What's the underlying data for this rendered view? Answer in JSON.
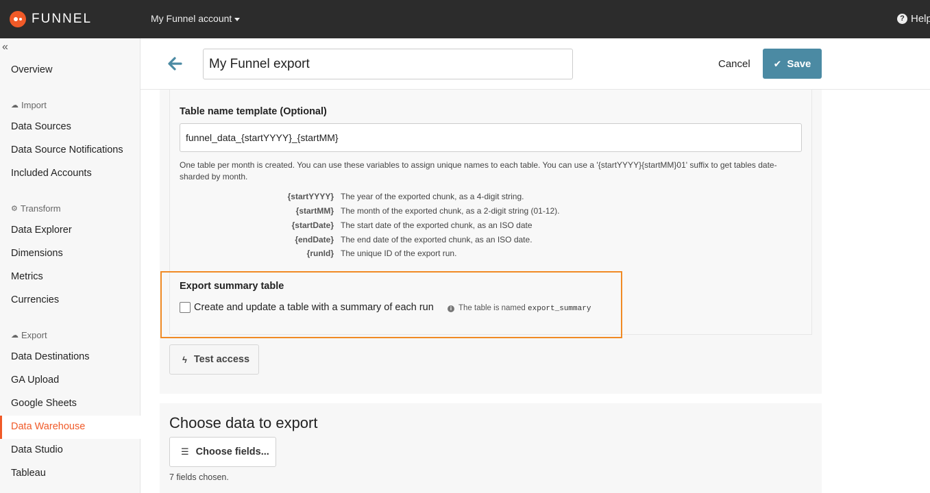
{
  "topbar": {
    "brand": "FUNNEL",
    "account": "My Funnel account",
    "help": "Help"
  },
  "sidebar": {
    "collapse_icon": "double-chevron-left-icon",
    "overview": "Overview",
    "sections": {
      "import": {
        "label": "Import",
        "icon": "cloud-upload-icon",
        "items": [
          "Data Sources",
          "Data Source Notifications",
          "Included Accounts"
        ]
      },
      "transform": {
        "label": "Transform",
        "icon": "gear-icon",
        "items": [
          "Data Explorer",
          "Dimensions",
          "Metrics",
          "Currencies"
        ]
      },
      "export": {
        "label": "Export",
        "icon": "cloud-download-icon",
        "items": [
          "Data Destinations",
          "GA Upload",
          "Google Sheets",
          "Data Warehouse",
          "Data Studio",
          "Tableau"
        ]
      }
    },
    "active_item": "Data Warehouse"
  },
  "header": {
    "export_name": "My Funnel export",
    "cancel": "Cancel",
    "save": "Save"
  },
  "table_template": {
    "label": "Table name template (Optional)",
    "value": "funnel_data_{startYYYY}_{startMM}",
    "help": "One table per month is created. You can use these variables to assign unique names to each table. You can use a '{startYYYY}{startMM}01' suffix to get tables date-sharded by month.",
    "variables": [
      {
        "name": "{startYYYY}",
        "desc": "The year of the exported chunk, as a 4-digit string."
      },
      {
        "name": "{startMM}",
        "desc": "The month of the exported chunk, as a 2-digit string (01-12)."
      },
      {
        "name": "{startDate}",
        "desc": "The start date of the exported chunk, as an ISO date"
      },
      {
        "name": "{endDate}",
        "desc": "The end date of the exported chunk, as an ISO date."
      },
      {
        "name": "{runId}",
        "desc": "The unique ID of the export run."
      }
    ]
  },
  "summary": {
    "title": "Export summary table",
    "checkbox_label": "Create and update a table with a summary of each run",
    "checked": false,
    "info_prefix": "The table is named",
    "info_code": "export_summary"
  },
  "test_access": "Test access",
  "choose_data": {
    "title": "Choose data to export",
    "button": "Choose fields...",
    "count": "7 fields chosen."
  },
  "colors": {
    "brand": "#f05a28",
    "save": "#4b8aa3",
    "highlight": "#f08a24"
  }
}
